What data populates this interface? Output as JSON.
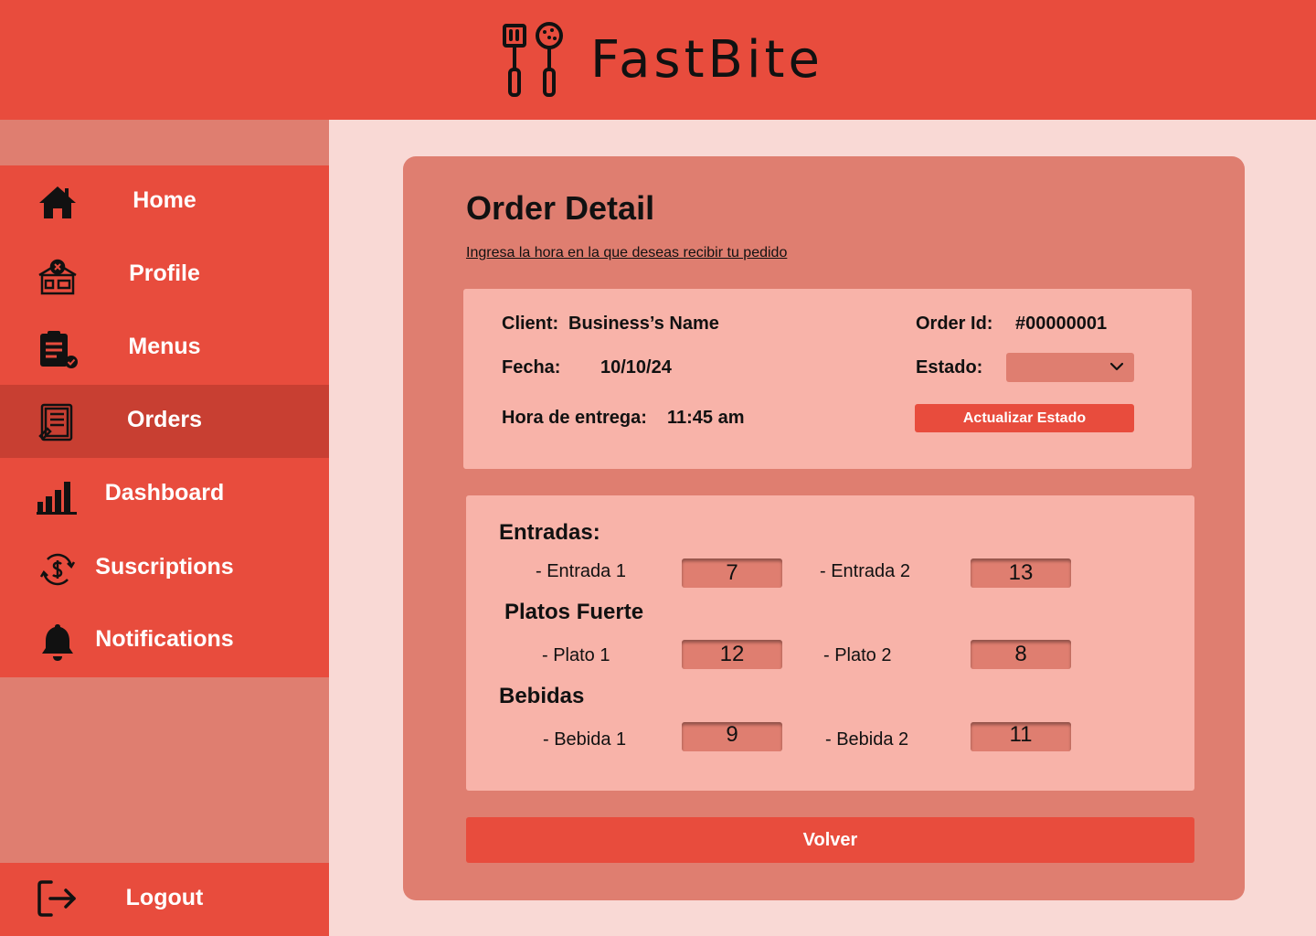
{
  "header": {
    "brand": "FastBite"
  },
  "sidebar": {
    "items": [
      {
        "label": "Home",
        "icon": "home-icon"
      },
      {
        "label": "Profile",
        "icon": "restaurant-icon"
      },
      {
        "label": "Menus",
        "icon": "clipboard-check-icon"
      },
      {
        "label": "Orders",
        "icon": "order-list-icon",
        "active": true
      },
      {
        "label": "Dashboard",
        "icon": "bar-chart-icon"
      },
      {
        "label": "Suscriptions",
        "icon": "dollar-cycle-icon"
      },
      {
        "label": "Notifications",
        "icon": "bell-icon"
      }
    ],
    "logout": {
      "label": "Logout",
      "icon": "logout-icon"
    }
  },
  "colors": {
    "primary": "#e84c3d",
    "sidebar": "#df7e70",
    "background": "#f9d9d5",
    "panel": "#f8b3a9",
    "active": "#c83f32"
  },
  "order": {
    "title": "Order Detail",
    "subtitle": "Ingresa la hora en la que deseas recibir tu pedido",
    "client_label": "Client:",
    "client_value": "Business’s Name",
    "fecha_label": "Fecha:",
    "fecha_value": "10/10/24",
    "hora_label": "Hora de entrega:",
    "hora_value": "11:45 am",
    "order_id_label": "Order Id:",
    "order_id_value": "#00000001",
    "estado_label": "Estado:",
    "estado_value": "",
    "update_button": "Actualizar Estado"
  },
  "sections": [
    {
      "title": "Entradas:",
      "items": [
        {
          "name": "- Entrada 1",
          "qty": "7"
        },
        {
          "name": "- Entrada 2",
          "qty": "13"
        }
      ]
    },
    {
      "title": "Platos Fuerte",
      "items": [
        {
          "name": "- Plato 1",
          "qty": "12"
        },
        {
          "name": "- Plato 2",
          "qty": "8"
        }
      ]
    },
    {
      "title": "Bebidas",
      "items": [
        {
          "name": "- Bebida 1",
          "qty": "9"
        },
        {
          "name": "- Bebida 2",
          "qty": "11"
        }
      ]
    }
  ],
  "back_button": "Volver"
}
